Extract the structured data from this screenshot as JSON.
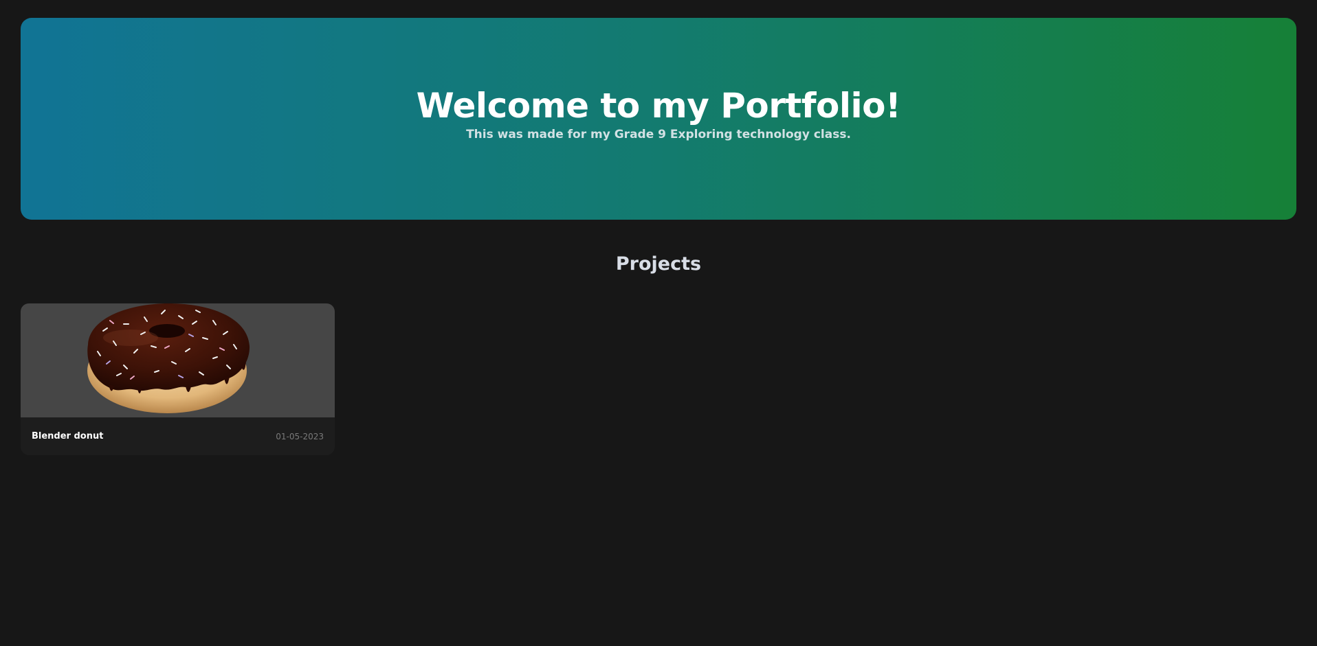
{
  "hero": {
    "title": "Welcome to my Portfolio!",
    "subtitle": "This was made for my Grade 9 Exploring technology class.",
    "gradient_start": "#117495",
    "gradient_end": "#168037"
  },
  "projects": {
    "heading": "Projects",
    "items": [
      {
        "title": "Blender donut",
        "date": "01-05-2023",
        "image": "donut-render"
      }
    ]
  },
  "colors": {
    "background": "#171717",
    "card_background": "#1d1d1d",
    "image_background": "#464646"
  }
}
